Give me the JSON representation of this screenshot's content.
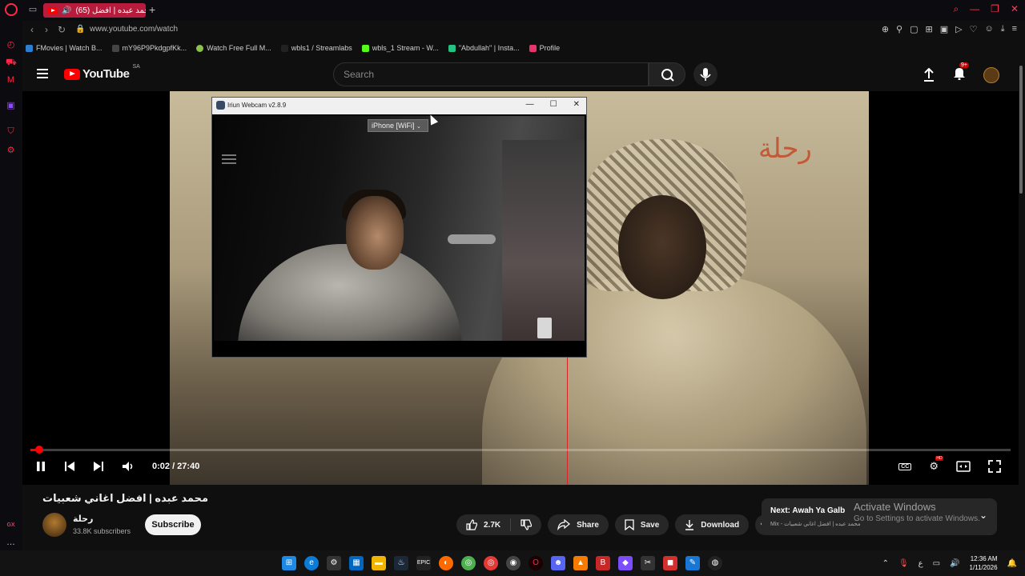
{
  "browser": {
    "tab_title": "(65) محمد عبده | افضل",
    "url": "www.youtube.com/watch",
    "bookmarks": [
      {
        "label": "FMovies | Watch B...",
        "color": "#2a7fd4"
      },
      {
        "label": "mY96P9PkdgpfKk...",
        "color": "#444444"
      },
      {
        "label": "Watch Free Full M...",
        "color": "#8bc34a"
      },
      {
        "label": "wbls1 / Streamlabs",
        "color": "#222222"
      },
      {
        "label": "wbls_1 Stream - W...",
        "color": "#53fc18"
      },
      {
        "label": "\"Abdullah\" | Insta...",
        "color": "#26c281"
      },
      {
        "label": "Profile",
        "color": "#e8336b"
      }
    ],
    "sidebar_label_gx": "GX"
  },
  "youtube": {
    "logo_text": "YouTube",
    "country_code": "SA",
    "search_placeholder": "Search",
    "notif_count": "9+"
  },
  "player": {
    "video_overlay_title": "رحلة",
    "time_display": "0:02 / 27:40",
    "progress_fraction": 0.0012
  },
  "iriun": {
    "window_title": "Iriun Webcam v2.8.9",
    "device": "iPhone [WiFi]"
  },
  "video": {
    "title": "محمد عبده | افضل اغاني شعبيات",
    "channel_name": "رحلة",
    "subscribers": "33.8K subscribers",
    "subscribe_label": "Subscribe",
    "likes": "2.7K",
    "share_label": "Share",
    "save_label": "Save",
    "download_label": "Download"
  },
  "next_up": {
    "label": "Next: Awah Ya Galb",
    "subtitle": "Mix - محمد عبده | افضل اغاني شعبيات"
  },
  "windows_activation": {
    "title": "Activate Windows",
    "subtitle": "Go to Settings to activate Windows."
  },
  "taskbar": {
    "clock_time": "12:36 AM",
    "clock_date": "1/11/2026",
    "lang": "ع"
  }
}
